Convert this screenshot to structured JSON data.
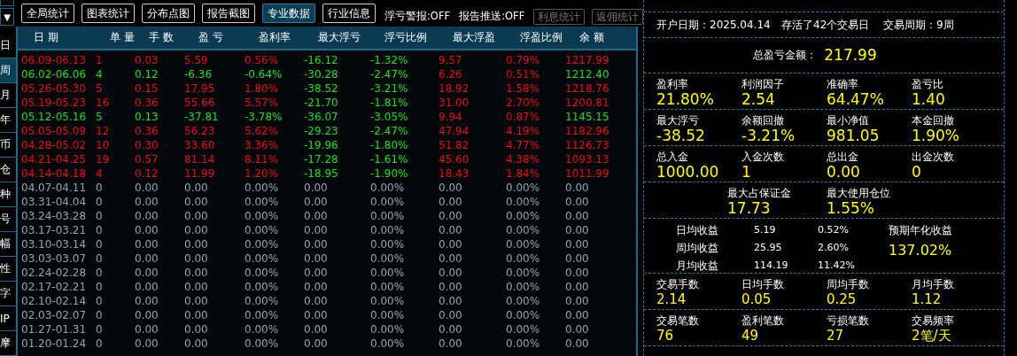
{
  "toolbar": {
    "buttons": [
      {
        "label": "全局统计",
        "selected": false
      },
      {
        "label": "图表统计",
        "selected": false
      },
      {
        "label": "分布点图",
        "selected": false
      },
      {
        "label": "报告截图",
        "selected": false
      },
      {
        "label": "专业数据",
        "selected": true
      },
      {
        "label": "行业信息",
        "selected": false
      }
    ],
    "switches": [
      "浮亏警报:OFF",
      "报告推送:OFF"
    ],
    "extra_buttons": [
      {
        "label": "利息统计",
        "disabled": true
      },
      {
        "label": "返佣统计",
        "disabled": true
      }
    ]
  },
  "sidebar": {
    "arrow": "▼",
    "tabs": [
      {
        "label": "日",
        "selected": false
      },
      {
        "label": "周",
        "selected": true
      },
      {
        "label": "月",
        "selected": false
      },
      {
        "label": "年",
        "selected": false
      },
      {
        "label": "币",
        "selected": false
      },
      {
        "label": "仓",
        "selected": false
      },
      {
        "label": "种",
        "selected": false
      },
      {
        "label": "号",
        "selected": false
      },
      {
        "label": "幅",
        "selected": false
      },
      {
        "label": "性",
        "selected": false
      },
      {
        "label": "字",
        "selected": false
      },
      {
        "label": "IP",
        "selected": false
      },
      {
        "label": "摩",
        "selected": false
      }
    ]
  },
  "table": {
    "columns": [
      {
        "label": "日 期",
        "kind": "result"
      },
      {
        "label": "单 量",
        "kind": "result"
      },
      {
        "label": "手 数",
        "kind": "result"
      },
      {
        "label": "盈 亏",
        "kind": "result"
      },
      {
        "label": "盈利率",
        "kind": "result"
      },
      {
        "label": "最大浮亏",
        "kind": "loss"
      },
      {
        "label": "浮亏比例",
        "kind": "loss"
      },
      {
        "label": "最大浮盈",
        "kind": "gain"
      },
      {
        "label": "浮盈比例",
        "kind": "gain"
      },
      {
        "label": "余 额",
        "kind": "result"
      }
    ],
    "rows": [
      {
        "traded": true,
        "profit": true,
        "cells": [
          "06.09-06.13",
          "1",
          "0.03",
          "5.59",
          "0.56%",
          "-16.12",
          "-1.32%",
          "9.57",
          "0.79%",
          "1217.99"
        ]
      },
      {
        "traded": true,
        "profit": false,
        "cells": [
          "06.02-06.06",
          "4",
          "0.12",
          "-6.36",
          "-0.64%",
          "-30.28",
          "-2.47%",
          "6.26",
          "0.51%",
          "1212.40"
        ]
      },
      {
        "traded": true,
        "profit": true,
        "cells": [
          "05.26-05.30",
          "5",
          "0.15",
          "17.95",
          "1.80%",
          "-38.52",
          "-3.21%",
          "18.92",
          "1.58%",
          "1218.76"
        ]
      },
      {
        "traded": true,
        "profit": true,
        "cells": [
          "05.19-05.23",
          "16",
          "0.36",
          "55.66",
          "5.57%",
          "-21.70",
          "-1.81%",
          "31.00",
          "2.70%",
          "1200.81"
        ]
      },
      {
        "traded": true,
        "profit": false,
        "cells": [
          "05.12-05.16",
          "5",
          "0.13",
          "-37.81",
          "-3.78%",
          "-36.07",
          "-3.05%",
          "9.94",
          "0.87%",
          "1145.15"
        ]
      },
      {
        "traded": true,
        "profit": true,
        "cells": [
          "05.05-05.09",
          "12",
          "0.36",
          "56.23",
          "5.62%",
          "-29.23",
          "-2.47%",
          "47.94",
          "4.19%",
          "1182.96"
        ]
      },
      {
        "traded": true,
        "profit": true,
        "cells": [
          "04.28-05.02",
          "10",
          "0.30",
          "33.60",
          "3.36%",
          "-19.96",
          "-1.80%",
          "51.82",
          "4.77%",
          "1126.73"
        ]
      },
      {
        "traded": true,
        "profit": true,
        "cells": [
          "04.21-04.25",
          "19",
          "0.57",
          "81.14",
          "8.11%",
          "-17.28",
          "-1.61%",
          "45.60",
          "4.38%",
          "1093.13"
        ]
      },
      {
        "traded": true,
        "profit": true,
        "cells": [
          "04.14-04.18",
          "4",
          "0.12",
          "11.99",
          "1.20%",
          "-18.95",
          "-1.90%",
          "18.43",
          "1.84%",
          "1011.99"
        ]
      },
      {
        "traded": false,
        "cells": [
          "04.07-04.11",
          "0",
          "0.00",
          "0.00",
          "0.00%",
          "0.00",
          "0.00%",
          "0.00",
          "0.00%",
          "0.00"
        ]
      },
      {
        "traded": false,
        "cells": [
          "03.31-04.04",
          "0",
          "0.00",
          "0.00",
          "0.00%",
          "0.00",
          "0.00%",
          "0.00",
          "0.00%",
          "0.00"
        ]
      },
      {
        "traded": false,
        "cells": [
          "03.24-03.28",
          "0",
          "0.00",
          "0.00",
          "0.00%",
          "0.00",
          "0.00%",
          "0.00",
          "0.00%",
          "0.00"
        ]
      },
      {
        "traded": false,
        "cells": [
          "03.17-03.21",
          "0",
          "0.00",
          "0.00",
          "0.00%",
          "0.00",
          "0.00%",
          "0.00",
          "0.00%",
          "0.00"
        ]
      },
      {
        "traded": false,
        "cells": [
          "03.10-03.14",
          "0",
          "0.00",
          "0.00",
          "0.00%",
          "0.00",
          "0.00%",
          "0.00",
          "0.00%",
          "0.00"
        ]
      },
      {
        "traded": false,
        "cells": [
          "03.03-03.07",
          "0",
          "0.00",
          "0.00",
          "0.00%",
          "0.00",
          "0.00%",
          "0.00",
          "0.00%",
          "0.00"
        ]
      },
      {
        "traded": false,
        "cells": [
          "02.24-02.28",
          "0",
          "0.00",
          "0.00",
          "0.00%",
          "0.00",
          "0.00%",
          "0.00",
          "0.00%",
          "0.00"
        ]
      },
      {
        "traded": false,
        "cells": [
          "02.17-02.21",
          "0",
          "0.00",
          "0.00",
          "0.00%",
          "0.00",
          "0.00%",
          "0.00",
          "0.00%",
          "0.00"
        ]
      },
      {
        "traded": false,
        "cells": [
          "02.10-02.14",
          "0",
          "0.00",
          "0.00",
          "0.00%",
          "0.00",
          "0.00%",
          "0.00",
          "0.00%",
          "0.00"
        ]
      },
      {
        "traded": false,
        "cells": [
          "02.03-02.07",
          "0",
          "0.00",
          "0.00",
          "0.00%",
          "0.00",
          "0.00%",
          "0.00",
          "0.00%",
          "0.00"
        ]
      },
      {
        "traded": false,
        "cells": [
          "01.27-01.31",
          "0",
          "0.00",
          "0.00",
          "0.00%",
          "0.00",
          "0.00%",
          "0.00",
          "0.00%",
          "0.00"
        ]
      },
      {
        "traded": false,
        "cells": [
          "01.20-01.24",
          "0",
          "0.00",
          "0.00",
          "0.00%",
          "0.00",
          "0.00%",
          "0.00",
          "0.00%",
          "0.00"
        ]
      }
    ]
  },
  "summary": {
    "account_row": [
      "开户日期：2025.04.14",
      "存活了42个交易日",
      "交易周期：9周"
    ],
    "total": {
      "label": "总盈亏金额：",
      "value": "217.99"
    },
    "stat_groups": [
      [
        {
          "label": "盈利率",
          "value": "21.80%"
        },
        {
          "label": "利润因子",
          "value": "2.54"
        },
        {
          "label": "准确率",
          "value": "64.47%"
        },
        {
          "label": "盈亏比",
          "value": "1.40"
        }
      ],
      [
        {
          "label": "最大浮亏",
          "value": "-38.52"
        },
        {
          "label": "余额回撤",
          "value": "-3.21%"
        },
        {
          "label": "最小净值",
          "value": "981.05"
        },
        {
          "label": "本金回撤",
          "value": "1.90%"
        }
      ],
      [
        {
          "label": "总入金",
          "value": "1000.00"
        },
        {
          "label": "入金次数",
          "value": "1"
        },
        {
          "label": "总出金",
          "value": "0.00"
        },
        {
          "label": "出金次数",
          "value": "0"
        }
      ]
    ],
    "margin_group": [
      {
        "label": "最大占保证金",
        "value": "17.73"
      },
      {
        "label": "最大使用仓位",
        "value": "1.55%"
      }
    ],
    "averages": [
      {
        "label": "日均收益",
        "amount": "5.19",
        "percent": "0.52%"
      },
      {
        "label": "周均收益",
        "amount": "25.95",
        "percent": "2.60%"
      },
      {
        "label": "月均收益",
        "amount": "114.19",
        "percent": "11.42%"
      }
    ],
    "annualized": {
      "label": "预期年化收益",
      "value": "137.02%"
    },
    "lot_groups": [
      [
        {
          "label": "交易手数",
          "value": "2.14"
        },
        {
          "label": "日均手数",
          "value": "0.05"
        },
        {
          "label": "周均手数",
          "value": "0.25"
        },
        {
          "label": "月均手数",
          "value": "1.12"
        }
      ],
      [
        {
          "label": "交易笔数",
          "value": "76"
        },
        {
          "label": "盈利笔数",
          "value": "49"
        },
        {
          "label": "亏损笔数",
          "value": "27"
        },
        {
          "label": "交易频率",
          "value": "2笔/天"
        }
      ]
    ]
  }
}
